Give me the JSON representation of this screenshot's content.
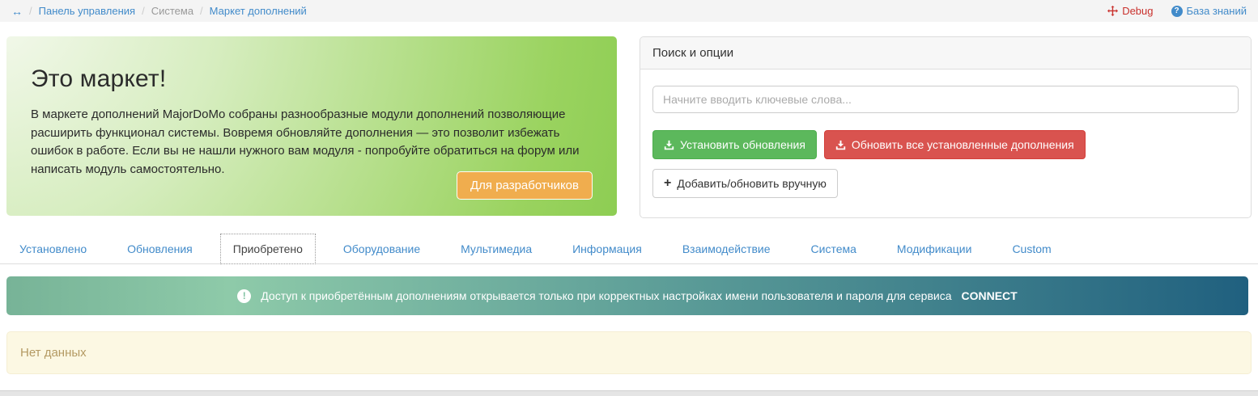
{
  "breadcrumb": {
    "separator": "/",
    "home_glyph": "↔",
    "items": [
      {
        "label": "Панель управления",
        "type": "link"
      },
      {
        "label": "Система",
        "type": "text"
      },
      {
        "label": "Маркет дополнений",
        "type": "link"
      }
    ]
  },
  "topbar_right": {
    "debug_label": "Debug",
    "knowledge_base_label": "База знаний",
    "question_glyph": "?"
  },
  "hero": {
    "title": "Это маркет!",
    "body": "В маркете дополнений MajorDoMo собраны разнообразные модули дополнений позволяющие расширить функционал системы. Вовремя обновляйте дополнения — это позволит избежать ошибок в работе. Если вы не нашли нужного вам модуля - попробуйте обратиться на форум или написать модуль самостоятельно.",
    "developers_button": "Для разработчиков"
  },
  "search_panel": {
    "title": "Поиск и опции",
    "search_placeholder": "Начните вводить ключевые слова...",
    "search_value": "",
    "install_updates_button": "Установить обновления",
    "update_all_button": "Обновить все установленные дополнения",
    "add_manual_button": "Добавить/обновить вручную",
    "plus_glyph": "+"
  },
  "tabs": [
    {
      "label": "Установлено",
      "active": false
    },
    {
      "label": "Обновления",
      "active": false
    },
    {
      "label": "Приобретено",
      "active": true
    },
    {
      "label": "Оборудование",
      "active": false
    },
    {
      "label": "Мультимедиа",
      "active": false
    },
    {
      "label": "Информация",
      "active": false
    },
    {
      "label": "Взаимодействие",
      "active": false
    },
    {
      "label": "Система",
      "active": false
    },
    {
      "label": "Модификации",
      "active": false
    },
    {
      "label": "Custom",
      "active": false
    }
  ],
  "notice": {
    "exclamation_glyph": "!",
    "text": "Доступ к приобретённым дополнениям открывается только при корректных настройках имени пользователя и пароля для сервиса",
    "service_name": "CONNECT"
  },
  "empty_state": {
    "message": "Нет данных"
  },
  "icons": {
    "home": "left-right-arrows-icon",
    "debug": "move-arrows-icon",
    "knowledge_base": "question-circle-icon",
    "install": "download-icon",
    "update_all": "download-icon",
    "add_manual": "plus-icon",
    "notice": "exclamation-circle-icon"
  },
  "colors": {
    "link_blue": "#428bca",
    "debug_red": "#c9302c",
    "hero_green": "#6fbf37",
    "developers_button_orange": "#f0ad4e",
    "install_green": "#5cb85c",
    "update_red": "#d9534f",
    "notice_gradient_start": "#77b397",
    "notice_gradient_end": "#20607f",
    "alert_bg": "#fcf8e3",
    "alert_text": "#b49a63"
  }
}
